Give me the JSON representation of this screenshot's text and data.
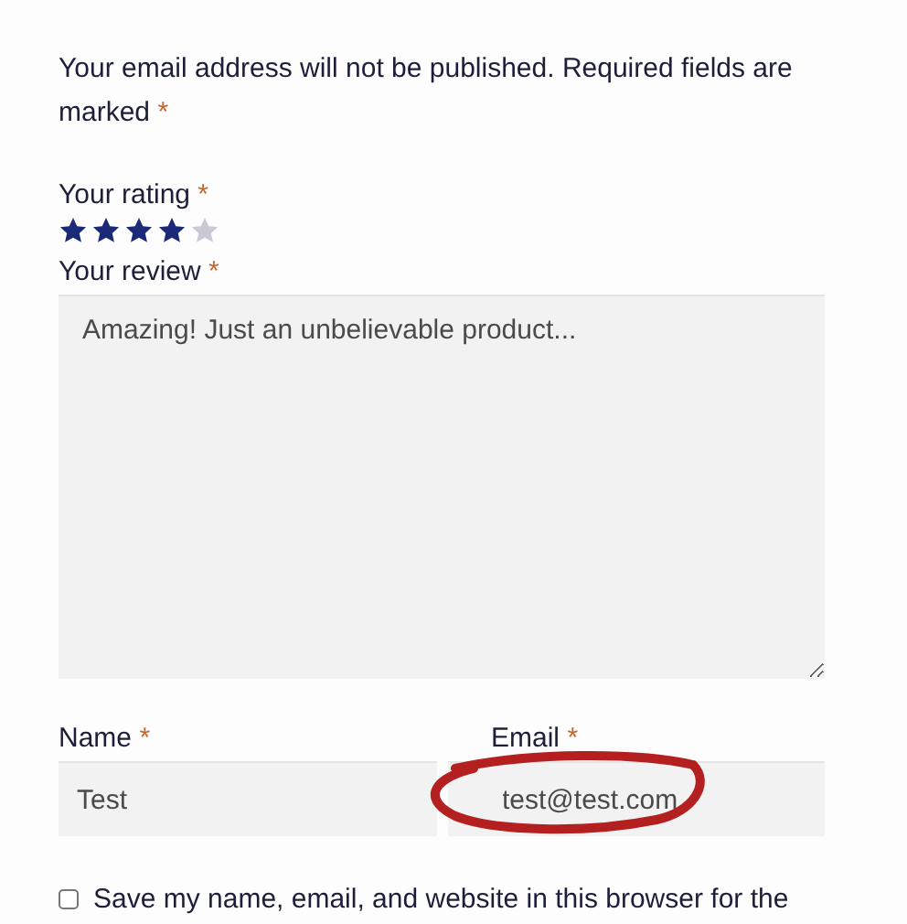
{
  "notice": {
    "text": "Your email address will not be published. Required fields are marked",
    "required_mark": "*"
  },
  "rating": {
    "label": "Your rating",
    "required_mark": "*",
    "stars": 4
  },
  "review": {
    "label": "Your review",
    "required_mark": "*",
    "value": "Amazing! Just an unbelievable product..."
  },
  "fields": [
    {
      "label": "Name",
      "required_mark": "*",
      "value": "Test",
      "highlighted": false
    },
    {
      "label": "Email",
      "required_mark": "*",
      "value": "test@test.com",
      "highlighted": true
    }
  ],
  "save_info": {
    "label": "Save my name, email, and website in this browser for the",
    "checked": false
  }
}
